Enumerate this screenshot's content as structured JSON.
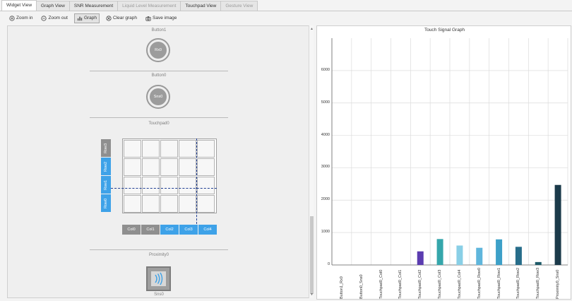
{
  "tabs": [
    {
      "label": "Widget View",
      "active": true,
      "enabled": true
    },
    {
      "label": "Graph View",
      "active": false,
      "enabled": true
    },
    {
      "label": "SNR Measurement",
      "active": false,
      "enabled": true
    },
    {
      "label": "Liquid Level Measurement",
      "active": false,
      "enabled": false
    },
    {
      "label": "Touchpad View",
      "active": false,
      "enabled": true
    },
    {
      "label": "Gesture View",
      "active": false,
      "enabled": false
    }
  ],
  "toolbar": {
    "zoom_in": "Zoom in",
    "zoom_out": "Zoom out",
    "graph": "Graph",
    "clear_graph": "Clear graph",
    "save_image": "Save image"
  },
  "widgets": {
    "button1": {
      "title": "Button1",
      "sensor": "Rx0"
    },
    "button0": {
      "title": "Button0",
      "sensor": "Sns0"
    },
    "touchpad": {
      "title": "Touchpad0",
      "rows": [
        "Row3",
        "Row2",
        "Row1",
        "Row0"
      ],
      "row_states": [
        "inactive",
        "active",
        "active",
        "active"
      ],
      "cols": [
        "Col0",
        "Col1",
        "Col2",
        "Col3",
        "Col4"
      ],
      "col_states": [
        "inactive",
        "inactive",
        "active",
        "active",
        "active"
      ]
    },
    "proximity": {
      "title": "Proximity0",
      "sensor": "Sns0"
    }
  },
  "colors": {
    "active_blue": "#3ea2e8",
    "inactive_gray": "#8f8f8f",
    "crosshair": "#1f3e93"
  },
  "chart_data": {
    "type": "bar",
    "title": "Touch Signal Graph",
    "xlabel": "",
    "ylabel": "",
    "ylim": [
      0,
      7000
    ],
    "yticks": [
      0,
      1000,
      2000,
      3000,
      4000,
      5000,
      6000
    ],
    "grid": true,
    "categories": [
      "Button1_Rx0",
      "Button0_Sns0",
      "Touchpad0_Col0",
      "Touchpad0_Col1",
      "Touchpad0_Col2",
      "Touchpad0_Col3",
      "Touchpad0_Col4",
      "Touchpad0_Row0",
      "Touchpad0_Row1",
      "Touchpad0_Row2",
      "Touchpad0_Row3",
      "Proximity0_Sns0"
    ],
    "values": [
      0,
      0,
      0,
      0,
      420,
      800,
      600,
      530,
      790,
      560,
      90,
      2470
    ],
    "bar_colors": [
      "#3b2b8a",
      "#3b2b8a",
      "#3b2b8a",
      "#3b2b8a",
      "#5b3cb0",
      "#35a6ab",
      "#89cfe6",
      "#5fb6dc",
      "#3da0c8",
      "#276d8a",
      "#1f5b69",
      "#1b3a4a"
    ]
  }
}
